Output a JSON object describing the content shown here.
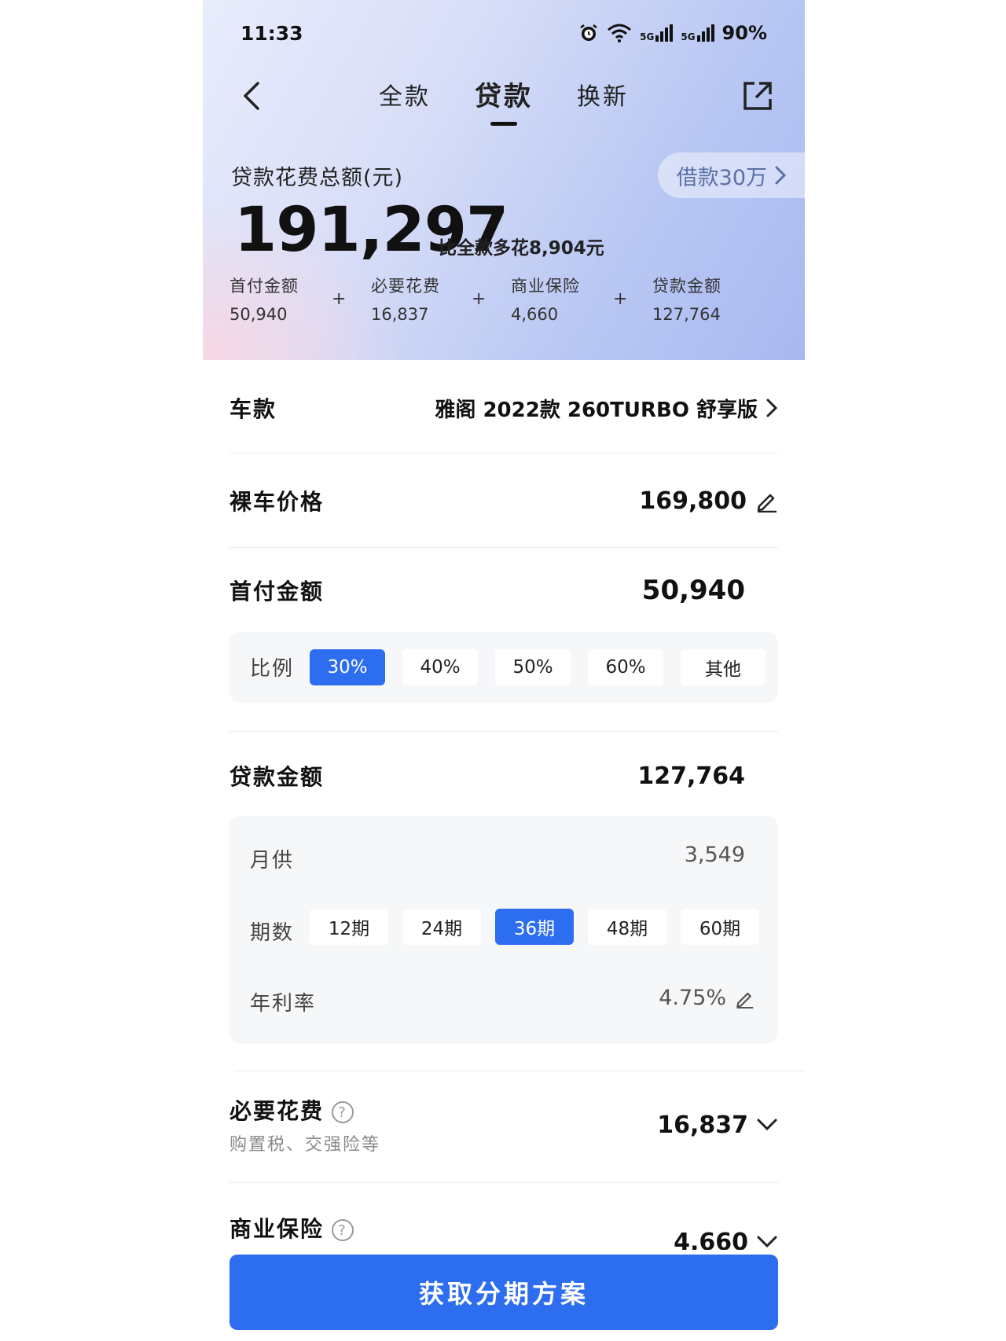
{
  "status_bar": {
    "time": "11:33",
    "network1": "5G",
    "network2": "5G",
    "battery": "90%"
  },
  "nav": {
    "tabs": [
      {
        "label": "全款"
      },
      {
        "label": "贷款"
      },
      {
        "label": "换新"
      }
    ],
    "active_tab": "贷款"
  },
  "summary": {
    "total_label": "贷款花费总额(元)",
    "borrow_pill": "借款30万",
    "total_amount": "191,297",
    "compare_text": "比全款多花8,904元",
    "breakdown": [
      {
        "label": "首付金额",
        "value": "50,940"
      },
      {
        "label": "必要花费",
        "value": "16,837"
      },
      {
        "label": "商业保险",
        "value": "4,660"
      },
      {
        "label": "贷款金额",
        "value": "127,764"
      }
    ],
    "plus": "+"
  },
  "car_model": {
    "label": "车款",
    "value": "雅阁 2022款 260TURBO 舒享版"
  },
  "base_price": {
    "label": "裸车价格",
    "value": "169,800"
  },
  "down_payment": {
    "label": "首付金额",
    "value": "50,940",
    "ratio_label": "比例",
    "ratio_options": [
      "30%",
      "40%",
      "50%",
      "60%",
      "其他"
    ],
    "selected_ratio": "30%"
  },
  "loan": {
    "label": "贷款金额",
    "value": "127,764",
    "monthly_label": "月供",
    "monthly_value": "3,549",
    "term_label": "期数",
    "term_options": [
      "12期",
      "24期",
      "36期",
      "48期",
      "60期"
    ],
    "selected_term": "36期",
    "rate_label": "年利率",
    "rate_value": "4.75%"
  },
  "necessary_costs": {
    "label": "必要花费",
    "sub": "购置税、交强险等",
    "value": "16,837"
  },
  "commercial_insurance": {
    "label": "商业保险",
    "value": "4,660"
  },
  "cta": {
    "label": "获取分期方案"
  },
  "colors": {
    "accent": "#2d6ef0",
    "hero_start": "#e9ecfb",
    "hero_end": "#a8b9f0"
  }
}
